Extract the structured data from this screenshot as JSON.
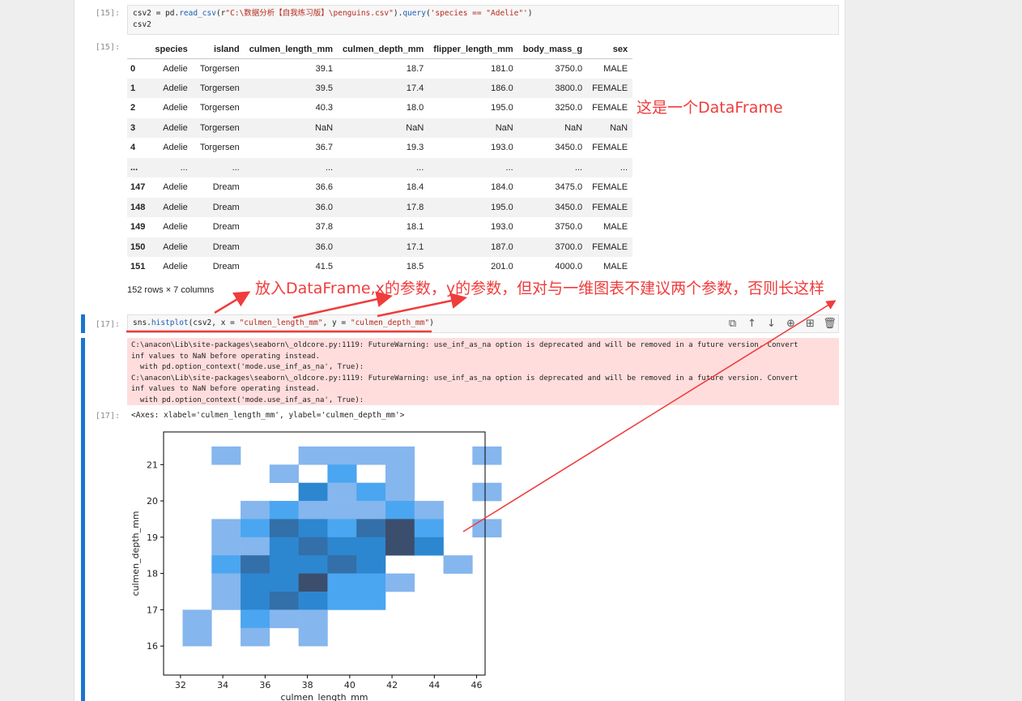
{
  "cell15": {
    "in_prompt": "[15]:",
    "code_line1_parts": [
      "csv2 = pd.",
      "read_csv",
      "(r",
      "\"C:\\数据分析【自我练习版】\\penguins.csv\"",
      ").",
      "query",
      "(",
      "'species == \"Adelie\"'",
      ")"
    ],
    "code_line2": "csv2",
    "out_prompt": "[15]:"
  },
  "dataframe": {
    "columns": [
      "",
      "species",
      "island",
      "culmen_length_mm",
      "culmen_depth_mm",
      "flipper_length_mm",
      "body_mass_g",
      "sex"
    ],
    "rows": [
      [
        "0",
        "Adelie",
        "Torgersen",
        "39.1",
        "18.7",
        "181.0",
        "3750.0",
        "MALE"
      ],
      [
        "1",
        "Adelie",
        "Torgersen",
        "39.5",
        "17.4",
        "186.0",
        "3800.0",
        "FEMALE"
      ],
      [
        "2",
        "Adelie",
        "Torgersen",
        "40.3",
        "18.0",
        "195.0",
        "3250.0",
        "FEMALE"
      ],
      [
        "3",
        "Adelie",
        "Torgersen",
        "NaN",
        "NaN",
        "NaN",
        "NaN",
        "NaN"
      ],
      [
        "4",
        "Adelie",
        "Torgersen",
        "36.7",
        "19.3",
        "193.0",
        "3450.0",
        "FEMALE"
      ],
      [
        "...",
        "...",
        "...",
        "...",
        "...",
        "...",
        "...",
        "..."
      ],
      [
        "147",
        "Adelie",
        "Dream",
        "36.6",
        "18.4",
        "184.0",
        "3475.0",
        "FEMALE"
      ],
      [
        "148",
        "Adelie",
        "Dream",
        "36.0",
        "17.8",
        "195.0",
        "3450.0",
        "FEMALE"
      ],
      [
        "149",
        "Adelie",
        "Dream",
        "37.8",
        "18.1",
        "193.0",
        "3750.0",
        "MALE"
      ],
      [
        "150",
        "Adelie",
        "Dream",
        "36.0",
        "17.1",
        "187.0",
        "3700.0",
        "FEMALE"
      ],
      [
        "151",
        "Adelie",
        "Dream",
        "41.5",
        "18.5",
        "201.0",
        "4000.0",
        "MALE"
      ]
    ],
    "shape_note": "152 rows × 7 columns"
  },
  "cell17": {
    "in_prompt": "[17]:",
    "code_parts": [
      "sns.",
      "histplot",
      "(csv2, x = ",
      "\"culmen_length_mm\"",
      ", y = ",
      "\"culmen_depth_mm\"",
      ")"
    ],
    "toolbar_icons": [
      "copy-icon",
      "move-up-icon",
      "move-down-icon",
      "insert-above-icon",
      "insert-below-icon",
      "delete-icon"
    ],
    "toolbar_glyphs": [
      "⧉",
      "↑",
      "↓",
      "⊕",
      "⊞",
      "🗑"
    ],
    "stderr_lines": [
      "C:\\anacon\\Lib\\site-packages\\seaborn\\_oldcore.py:1119: FutureWarning: use_inf_as_na option is deprecated and will be removed in a future version. Convert",
      "inf values to NaN before operating instead.",
      "  with pd.option_context('mode.use_inf_as_na', True):",
      "C:\\anacon\\Lib\\site-packages\\seaborn\\_oldcore.py:1119: FutureWarning: use_inf_as_na option is deprecated and will be removed in a future version. Convert",
      "inf values to NaN before operating instead.",
      "  with pd.option_context('mode.use_inf_as_na', True):"
    ],
    "out_prompt": "[17]:",
    "repr": "<Axes: xlabel='culmen_length_mm', ylabel='culmen_depth_mm'>"
  },
  "annotations": {
    "dataframe_note": "这是一个DataFrame",
    "params_note": "放入DataFrame,x的参数，y的参数，但对与一维图表不建议两个参数，否则长这样",
    "color": "#f03c3c"
  },
  "chart_data": {
    "type": "heatmap",
    "xlabel": "culmen_length_mm",
    "ylabel": "culmen_depth_mm",
    "xlim": [
      31.2,
      46.4
    ],
    "ylim": [
      15.2,
      21.9
    ],
    "x_ticks": [
      "32",
      "34",
      "36",
      "38",
      "40",
      "42",
      "44",
      "46"
    ],
    "y_ticks": [
      "16",
      "17",
      "18",
      "19",
      "20",
      "21"
    ],
    "bin_x_edges": [
      32.1,
      33.47,
      34.84,
      36.21,
      37.58,
      38.95,
      40.32,
      41.69,
      43.06,
      44.43,
      45.8
    ],
    "bin_y_edges": [
      15.5,
      16.0,
      16.5,
      17.0,
      17.5,
      18.0,
      18.5,
      19.0,
      19.5,
      20.0,
      20.5,
      21.0
    ],
    "bin_width_x": 1.37,
    "bin_height_y": 0.5,
    "intensity_note": "cell values are relative density levels 1 (lightest) to 5 (darkest)",
    "cells": [
      {
        "x": 33.47,
        "y": 21.0,
        "v": 1
      },
      {
        "x": 37.58,
        "y": 21.0,
        "v": 1
      },
      {
        "x": 38.95,
        "y": 21.0,
        "v": 1
      },
      {
        "x": 40.32,
        "y": 21.0,
        "v": 1
      },
      {
        "x": 41.69,
        "y": 21.0,
        "v": 1
      },
      {
        "x": 45.8,
        "y": 21.0,
        "v": 1
      },
      {
        "x": 36.21,
        "y": 20.5,
        "v": 1
      },
      {
        "x": 38.95,
        "y": 20.5,
        "v": 2
      },
      {
        "x": 41.69,
        "y": 20.5,
        "v": 1
      },
      {
        "x": 37.58,
        "y": 20.0,
        "v": 3
      },
      {
        "x": 38.95,
        "y": 20.0,
        "v": 1
      },
      {
        "x": 40.32,
        "y": 20.0,
        "v": 2
      },
      {
        "x": 41.69,
        "y": 20.0,
        "v": 1
      },
      {
        "x": 45.8,
        "y": 20.0,
        "v": 1
      },
      {
        "x": 34.84,
        "y": 19.5,
        "v": 1
      },
      {
        "x": 36.21,
        "y": 19.5,
        "v": 2
      },
      {
        "x": 37.58,
        "y": 19.5,
        "v": 1
      },
      {
        "x": 38.95,
        "y": 19.5,
        "v": 1
      },
      {
        "x": 40.32,
        "y": 19.5,
        "v": 1
      },
      {
        "x": 41.69,
        "y": 19.5,
        "v": 2
      },
      {
        "x": 43.06,
        "y": 19.5,
        "v": 1
      },
      {
        "x": 33.47,
        "y": 19.0,
        "v": 1
      },
      {
        "x": 34.84,
        "y": 19.0,
        "v": 2
      },
      {
        "x": 36.21,
        "y": 19.0,
        "v": 4
      },
      {
        "x": 37.58,
        "y": 19.0,
        "v": 3
      },
      {
        "x": 38.95,
        "y": 19.0,
        "v": 2
      },
      {
        "x": 40.32,
        "y": 19.0,
        "v": 4
      },
      {
        "x": 41.69,
        "y": 19.0,
        "v": 5
      },
      {
        "x": 43.06,
        "y": 19.0,
        "v": 2
      },
      {
        "x": 45.8,
        "y": 19.0,
        "v": 1
      },
      {
        "x": 33.47,
        "y": 18.5,
        "v": 1
      },
      {
        "x": 34.84,
        "y": 18.5,
        "v": 1
      },
      {
        "x": 36.21,
        "y": 18.5,
        "v": 3
      },
      {
        "x": 37.58,
        "y": 18.5,
        "v": 4
      },
      {
        "x": 38.95,
        "y": 18.5,
        "v": 3
      },
      {
        "x": 40.32,
        "y": 18.5,
        "v": 3
      },
      {
        "x": 41.69,
        "y": 18.5,
        "v": 5
      },
      {
        "x": 43.06,
        "y": 18.5,
        "v": 3
      },
      {
        "x": 33.47,
        "y": 18.0,
        "v": 2
      },
      {
        "x": 34.84,
        "y": 18.0,
        "v": 4
      },
      {
        "x": 36.21,
        "y": 18.0,
        "v": 3
      },
      {
        "x": 37.58,
        "y": 18.0,
        "v": 3
      },
      {
        "x": 38.95,
        "y": 18.0,
        "v": 4
      },
      {
        "x": 40.32,
        "y": 18.0,
        "v": 3
      },
      {
        "x": 44.43,
        "y": 18.0,
        "v": 1
      },
      {
        "x": 33.47,
        "y": 17.5,
        "v": 1
      },
      {
        "x": 34.84,
        "y": 17.5,
        "v": 3
      },
      {
        "x": 36.21,
        "y": 17.5,
        "v": 3
      },
      {
        "x": 37.58,
        "y": 17.5,
        "v": 5
      },
      {
        "x": 38.95,
        "y": 17.5,
        "v": 2
      },
      {
        "x": 40.32,
        "y": 17.5,
        "v": 2
      },
      {
        "x": 41.69,
        "y": 17.5,
        "v": 1
      },
      {
        "x": 33.47,
        "y": 17.0,
        "v": 1
      },
      {
        "x": 34.84,
        "y": 17.0,
        "v": 3
      },
      {
        "x": 36.21,
        "y": 17.0,
        "v": 4
      },
      {
        "x": 37.58,
        "y": 17.0,
        "v": 3
      },
      {
        "x": 38.95,
        "y": 17.0,
        "v": 2
      },
      {
        "x": 40.32,
        "y": 17.0,
        "v": 2
      },
      {
        "x": 32.1,
        "y": 16.5,
        "v": 1
      },
      {
        "x": 34.84,
        "y": 16.5,
        "v": 2
      },
      {
        "x": 36.21,
        "y": 16.5,
        "v": 1
      },
      {
        "x": 37.58,
        "y": 16.5,
        "v": 1
      },
      {
        "x": 32.1,
        "y": 16.0,
        "v": 1
      },
      {
        "x": 34.84,
        "y": 16.0,
        "v": 1
      },
      {
        "x": 37.58,
        "y": 16.0,
        "v": 1
      }
    ],
    "colors": {
      "1": "#85b6ee",
      "2": "#4aa6f0",
      "3": "#2d86d0",
      "4": "#336fa8",
      "5": "#3c4e6d"
    },
    "grid": false
  }
}
